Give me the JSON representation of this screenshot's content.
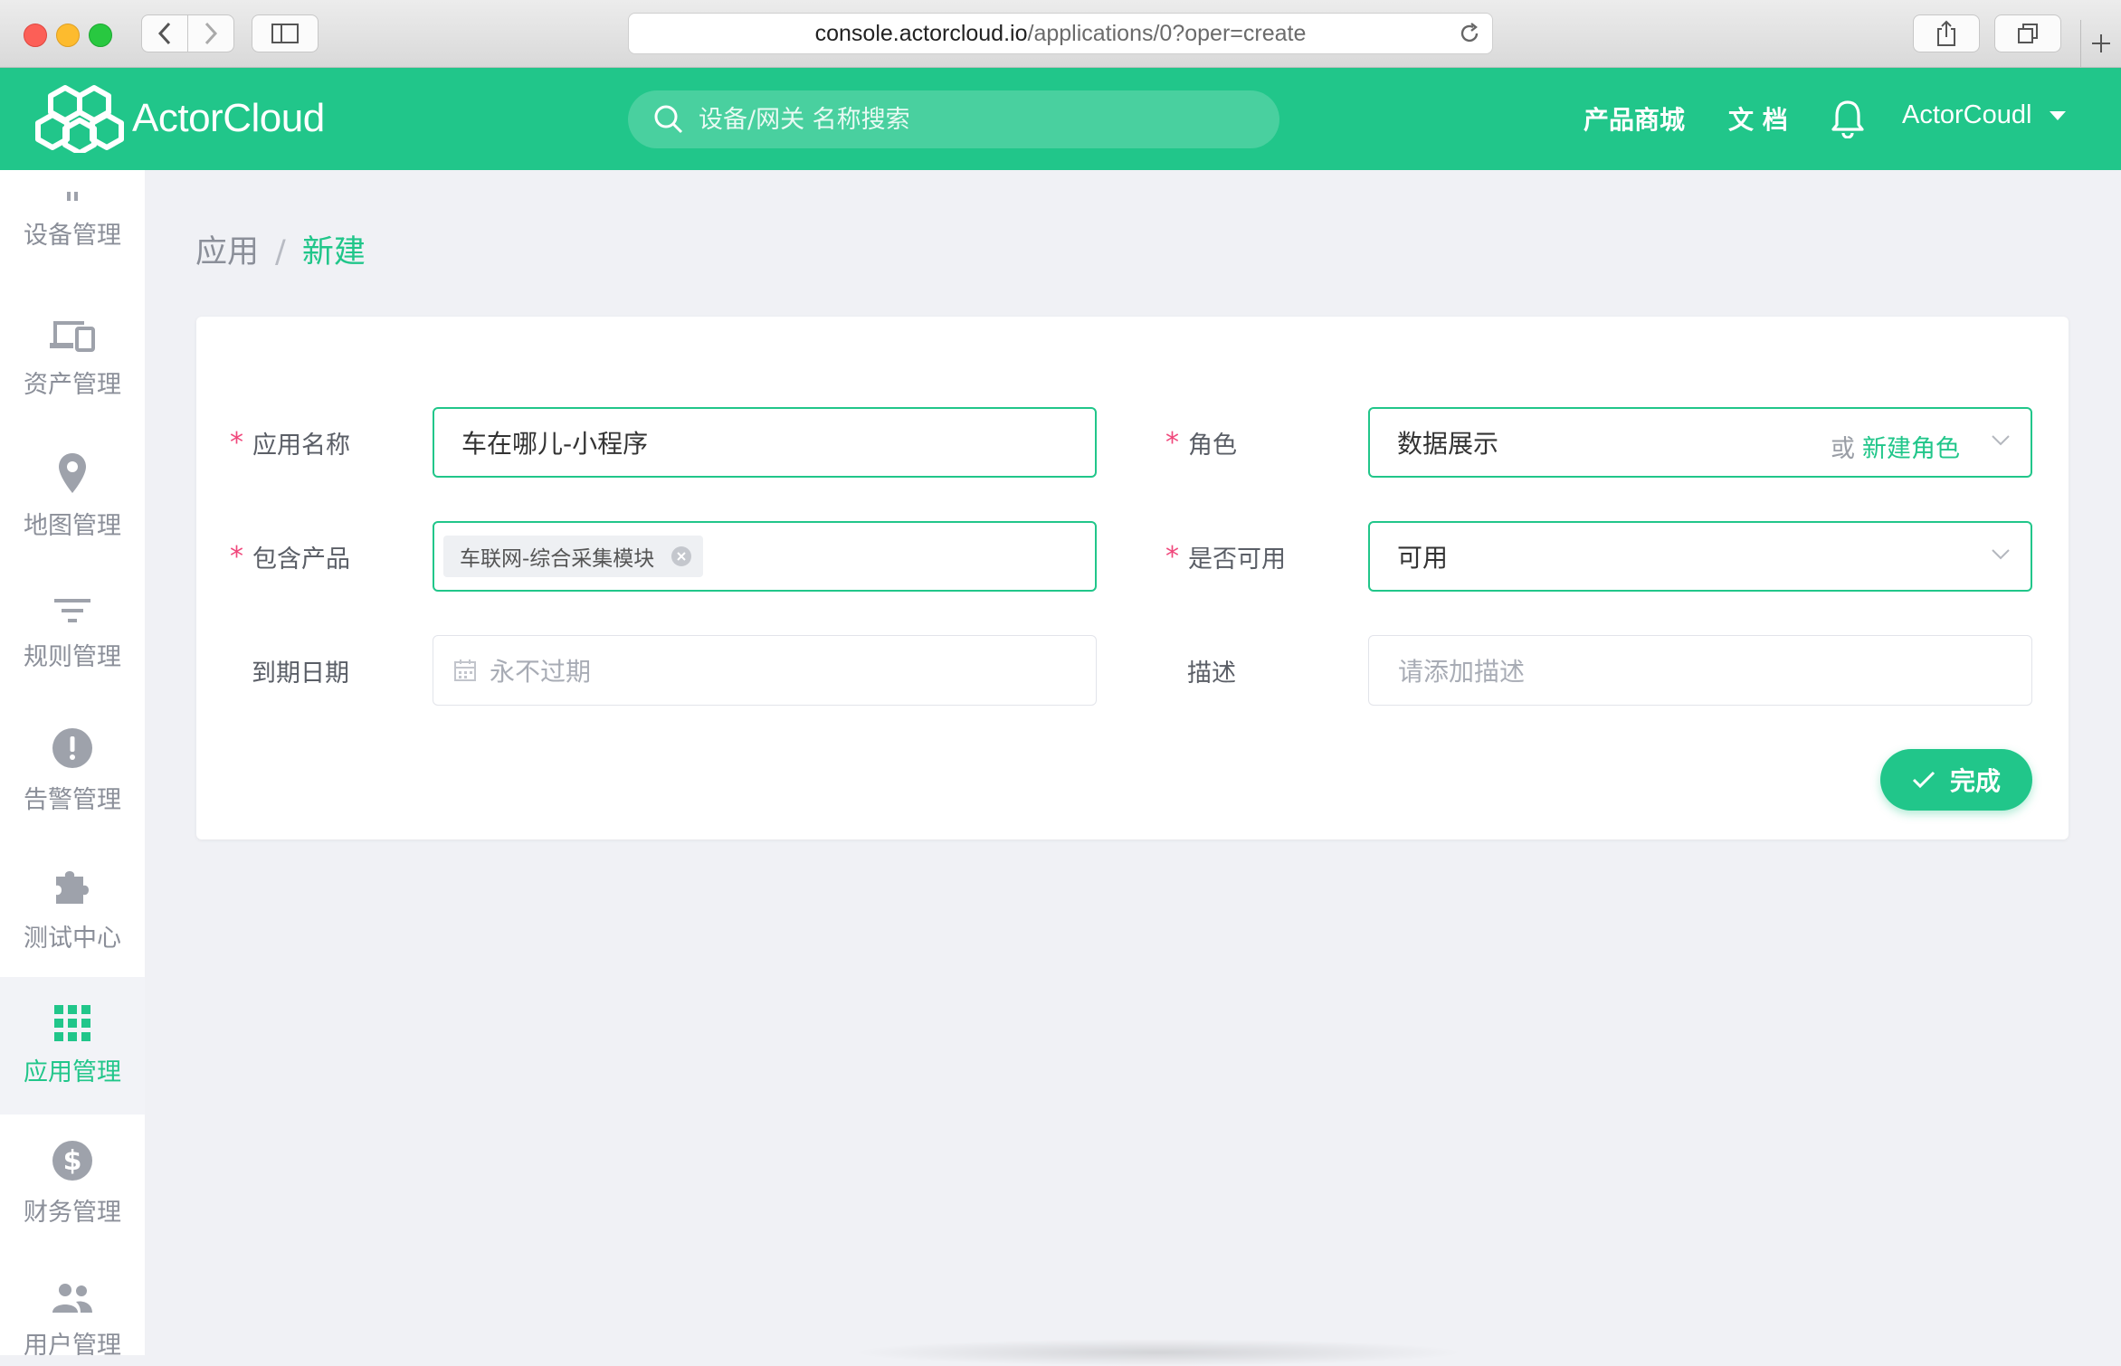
{
  "browser": {
    "url_host": "console.actorcloud.io",
    "url_path": "/applications/0?oper=create"
  },
  "header": {
    "brand": "ActorCloud",
    "search_placeholder": "设备/网关 名称搜索",
    "nav": [
      "产品商城",
      "文 档"
    ],
    "user": "ActorCoudl"
  },
  "sidebar": {
    "items": [
      {
        "label": "设备管理",
        "icon": "device-icon"
      },
      {
        "label": "资产管理",
        "icon": "devices-icon"
      },
      {
        "label": "地图管理",
        "icon": "map-pin-icon"
      },
      {
        "label": "规则管理",
        "icon": "filter-icon"
      },
      {
        "label": "告警管理",
        "icon": "alert-icon"
      },
      {
        "label": "测试中心",
        "icon": "puzzle-icon"
      },
      {
        "label": "应用管理",
        "icon": "grid-icon",
        "active": true
      },
      {
        "label": "财务管理",
        "icon": "dollar-icon"
      },
      {
        "label": "用户管理",
        "icon": "users-icon"
      }
    ]
  },
  "breadcrumb": {
    "parent": "应用",
    "separator": "/",
    "current": "新建"
  },
  "form": {
    "app_name": {
      "label": "应用名称",
      "value": "车在哪儿-小程序"
    },
    "role": {
      "label": "角色",
      "value": "数据展示",
      "or": "或",
      "create": "新建角色"
    },
    "products": {
      "label": "包含产品",
      "tag": "车联网-综合采集模块"
    },
    "availability": {
      "label": "是否可用",
      "value": "可用"
    },
    "expiry": {
      "label": "到期日期",
      "placeholder": "永不过期"
    },
    "description": {
      "label": "描述",
      "placeholder": "请添加描述"
    },
    "submit": "完成"
  },
  "colors": {
    "accent": "#21c68a",
    "required": "#f0487c"
  }
}
